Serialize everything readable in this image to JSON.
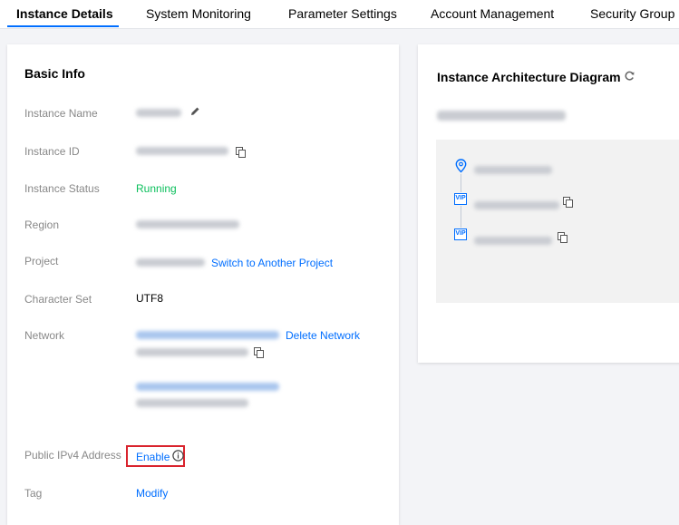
{
  "tabs": [
    {
      "label": "Instance Details",
      "active": true
    },
    {
      "label": "System Monitoring",
      "active": false
    },
    {
      "label": "Parameter Settings",
      "active": false
    },
    {
      "label": "Account Management",
      "active": false
    },
    {
      "label": "Security Group",
      "active": false
    }
  ],
  "basic_info": {
    "title": "Basic Info",
    "labels": {
      "instance_name": "Instance Name",
      "instance_id": "Instance ID",
      "instance_status": "Instance Status",
      "region": "Region",
      "project": "Project",
      "character_set": "Character Set",
      "network": "Network",
      "public_ipv4": "Public IPv4 Address",
      "tag": "Tag"
    },
    "values": {
      "instance_status": "Running",
      "switch_project_link": "Switch to Another Project",
      "character_set": "UTF8",
      "delete_network_link": "Delete Network",
      "enable_link": "Enable",
      "modify_link": "Modify"
    }
  },
  "architecture": {
    "title": "Instance Architecture Diagram",
    "vip_badge": "VIP"
  },
  "colors": {
    "accent": "#006eff",
    "status_running": "#0abf5b",
    "highlight_border": "#d9232d"
  },
  "icons": [
    "pencil-icon",
    "copy-icon",
    "refresh-icon",
    "location-pin-icon",
    "info-icon",
    "vip-icon"
  ]
}
